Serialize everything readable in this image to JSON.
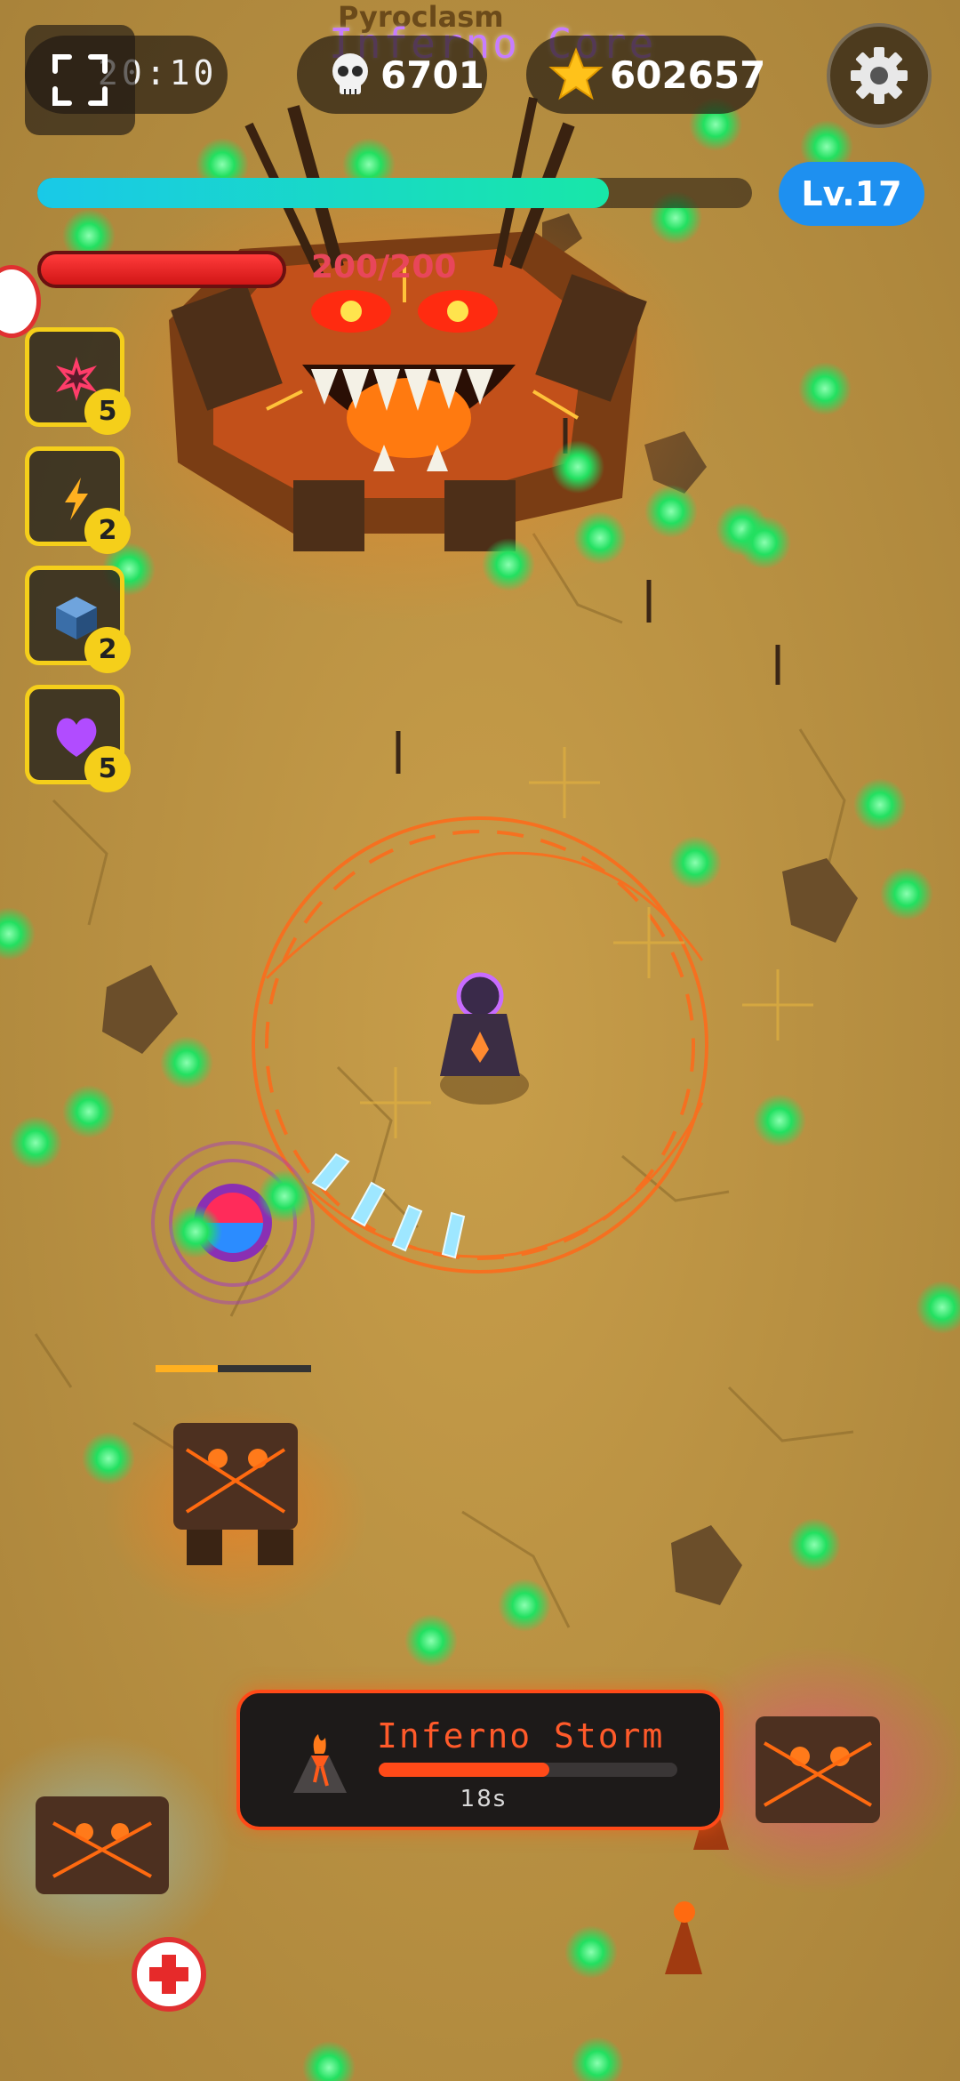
{
  "hud": {
    "timer": "20:10",
    "kills": "6701",
    "score": "602657",
    "level": "Lv.17",
    "xp_fraction": 0.8,
    "hp_text": "200/200",
    "hp_fraction": 1.0
  },
  "boss": {
    "name": "Inferno Core",
    "subname": "Pyroclasm"
  },
  "skills": [
    {
      "icon": "rage-burst-icon",
      "count": "5"
    },
    {
      "icon": "lightning-icon",
      "count": "2"
    },
    {
      "icon": "cube-icon",
      "count": "2"
    },
    {
      "icon": "heart-icon",
      "count": "5"
    }
  ],
  "event": {
    "icon": "volcano-icon",
    "title": "Inferno Storm",
    "timer": "18s",
    "progress": 0.57
  },
  "colors": {
    "ground": "#b68f3e",
    "xp_gradient_start": "#19c9e8",
    "xp_gradient_end": "#18e7a8",
    "hp_red": "#e02020",
    "level_blue": "#1e90f0",
    "skill_border": "#f5cf1a",
    "event_orange": "#ff4a18",
    "orb_green": "#22e060",
    "boss_name_purple": "#c77dff"
  }
}
